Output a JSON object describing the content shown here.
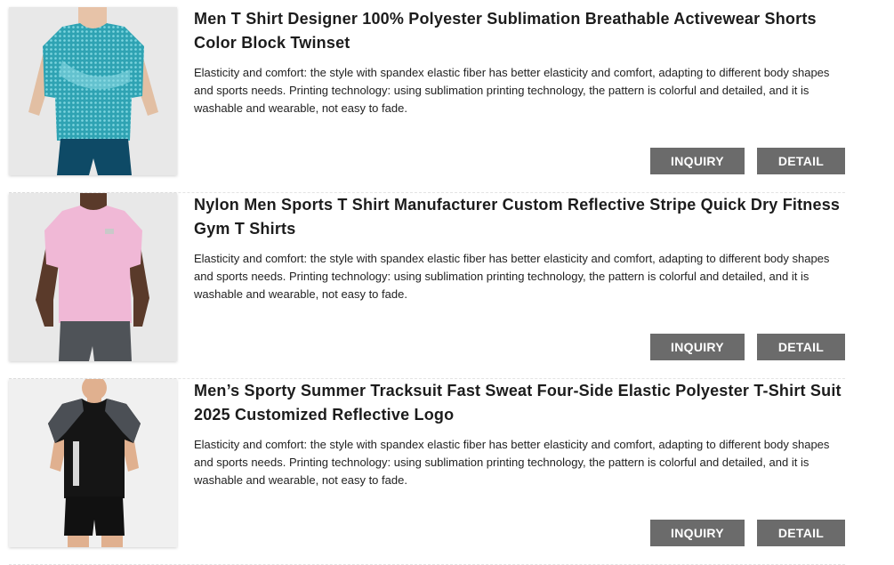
{
  "products": [
    {
      "title": "Men T Shirt Designer 100% Polyester Sublimation Breathable Activewear Shorts Color Block Twinset",
      "description": "Elasticity and comfort: the style with spandex elastic fiber has better elasticity and comfort, adapting to different body shapes and sports needs. Printing technology: using sublimation printing technology, the pattern is colorful and detailed, and it is washable and wearable, not easy to fade.",
      "inquiry_label": "INQUIRY",
      "detail_label": "DETAIL",
      "image_name": "teal-printed-tshirt-photo"
    },
    {
      "title": "Nylon Men Sports T Shirt Manufacturer Custom Reflective Stripe Quick Dry Fitness Gym T Shirts",
      "description": "Elasticity and comfort: the style with spandex elastic fiber has better elasticity and comfort, adapting to different body shapes and sports needs. Printing technology: using sublimation printing technology, the pattern is colorful and detailed, and it is washable and wearable, not easy to fade.",
      "inquiry_label": "INQUIRY",
      "detail_label": "DETAIL",
      "image_name": "pink-tshirt-photo"
    },
    {
      "title": "Men’s Sporty Summer Tracksuit Fast Sweat Four-Side Elastic Polyester T-Shirt Suit 2025 Customized Reflective Logo",
      "description": "Elasticity and comfort: the style with spandex elastic fiber has better elasticity and comfort, adapting to different body shapes and sports needs. Printing technology: using sublimation printing technology, the pattern is colorful and detailed, and it is washable and wearable, not easy to fade.",
      "inquiry_label": "INQUIRY",
      "detail_label": "DETAIL",
      "image_name": "black-tracksuit-photo"
    }
  ],
  "colors": {
    "button_bg": "#6b6b6b",
    "button_text": "#ffffff",
    "title_text": "#1c1c1c"
  }
}
